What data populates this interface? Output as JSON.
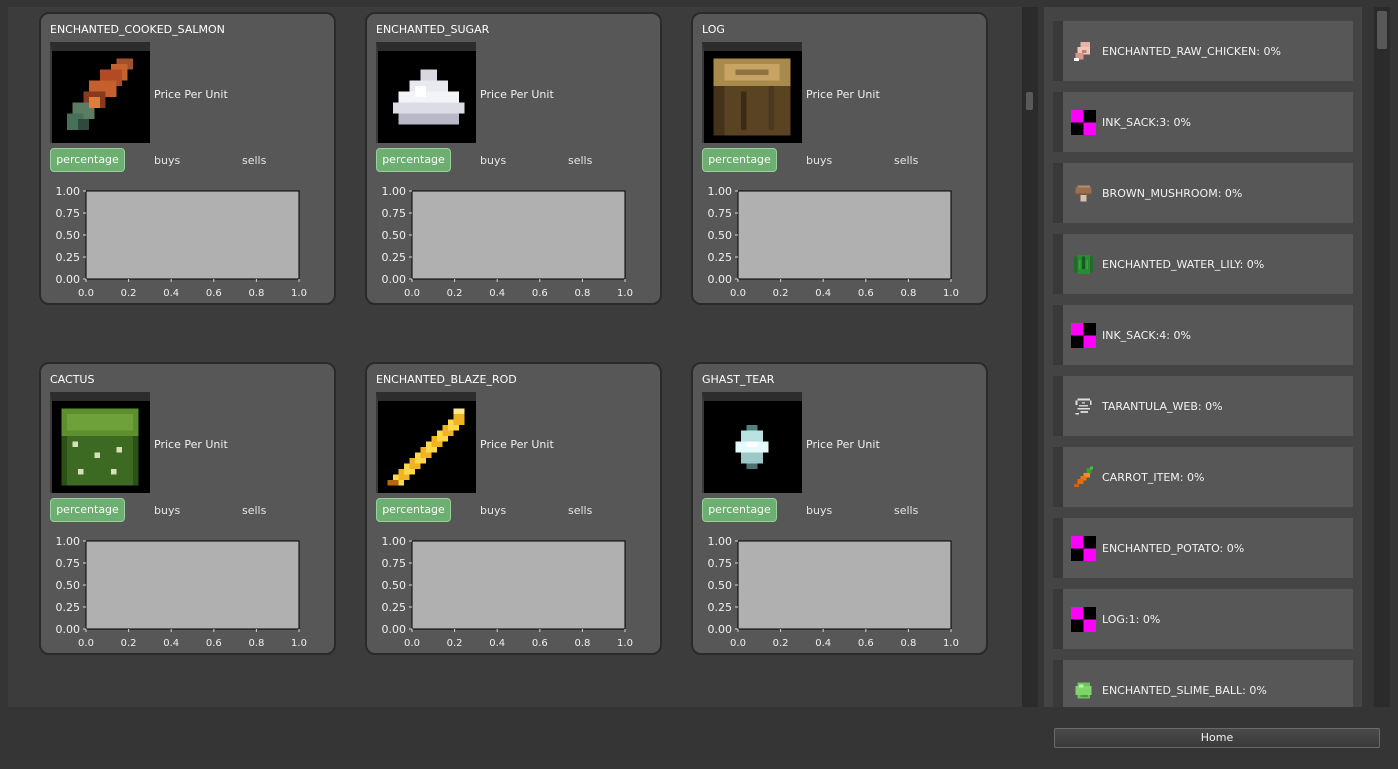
{
  "cards": [
    {
      "title": "ENCHANTED_COOKED_SALMON",
      "icon": "cooked-salmon-icon"
    },
    {
      "title": "ENCHANTED_SUGAR",
      "icon": "sugar-icon"
    },
    {
      "title": "LOG",
      "icon": "log-icon"
    },
    {
      "title": "CACTUS",
      "icon": "cactus-icon"
    },
    {
      "title": "ENCHANTED_BLAZE_ROD",
      "icon": "blaze-rod-icon"
    },
    {
      "title": "GHAST_TEAR",
      "icon": "ghast-tear-icon"
    }
  ],
  "card_labels": {
    "price_per_unit": "Price Per Unit",
    "percentage": "percentage",
    "buys": "buys",
    "sells": "sells"
  },
  "chart_data": [
    {
      "type": "line",
      "x": [],
      "series": [],
      "xlim": [
        0.0,
        1.0
      ],
      "ylim": [
        0.0,
        1.0
      ],
      "yticks": [
        "1.00",
        "0.75",
        "0.50",
        "0.25",
        "0.00"
      ],
      "xticks": [
        "0.0",
        "0.2",
        "0.4",
        "0.6",
        "0.8",
        "1.0"
      ]
    },
    {
      "type": "line",
      "x": [],
      "series": [],
      "xlim": [
        0.0,
        1.0
      ],
      "ylim": [
        0.0,
        1.0
      ],
      "yticks": [
        "1.00",
        "0.75",
        "0.50",
        "0.25",
        "0.00"
      ],
      "xticks": [
        "0.0",
        "0.2",
        "0.4",
        "0.6",
        "0.8",
        "1.0"
      ]
    },
    {
      "type": "line",
      "x": [],
      "series": [],
      "xlim": [
        0.0,
        1.0
      ],
      "ylim": [
        0.0,
        1.0
      ],
      "yticks": [
        "1.00",
        "0.75",
        "0.50",
        "0.25",
        "0.00"
      ],
      "xticks": [
        "0.0",
        "0.2",
        "0.4",
        "0.6",
        "0.8",
        "1.0"
      ]
    },
    {
      "type": "line",
      "x": [],
      "series": [],
      "xlim": [
        0.0,
        1.0
      ],
      "ylim": [
        0.0,
        1.0
      ],
      "yticks": [
        "1.00",
        "0.75",
        "0.50",
        "0.25",
        "0.00"
      ],
      "xticks": [
        "0.0",
        "0.2",
        "0.4",
        "0.6",
        "0.8",
        "1.0"
      ]
    },
    {
      "type": "line",
      "x": [],
      "series": [],
      "xlim": [
        0.0,
        1.0
      ],
      "ylim": [
        0.0,
        1.0
      ],
      "yticks": [
        "1.00",
        "0.75",
        "0.50",
        "0.25",
        "0.00"
      ],
      "xticks": [
        "0.0",
        "0.2",
        "0.4",
        "0.6",
        "0.8",
        "1.0"
      ]
    },
    {
      "type": "line",
      "x": [],
      "series": [],
      "xlim": [
        0.0,
        1.0
      ],
      "ylim": [
        0.0,
        1.0
      ],
      "yticks": [
        "1.00",
        "0.75",
        "0.50",
        "0.25",
        "0.00"
      ],
      "xticks": [
        "0.0",
        "0.2",
        "0.4",
        "0.6",
        "0.8",
        "1.0"
      ]
    }
  ],
  "sidebar": {
    "items": [
      {
        "label": "ENCHANTED_RAW_CHICKEN: 0%",
        "icon": "raw-chicken-icon"
      },
      {
        "label": "INK_SACK:3: 0%",
        "icon": "missing-texture-icon"
      },
      {
        "label": "BROWN_MUSHROOM: 0%",
        "icon": "brown-mushroom-icon"
      },
      {
        "label": "ENCHANTED_WATER_LILY: 0%",
        "icon": "water-lily-icon"
      },
      {
        "label": "INK_SACK:4: 0%",
        "icon": "missing-texture-icon"
      },
      {
        "label": "TARANTULA_WEB: 0%",
        "icon": "tarantula-web-icon"
      },
      {
        "label": "CARROT_ITEM: 0%",
        "icon": "carrot-icon"
      },
      {
        "label": "ENCHANTED_POTATO: 0%",
        "icon": "missing-texture-icon"
      },
      {
        "label": "LOG:1: 0%",
        "icon": "missing-texture-icon"
      },
      {
        "label": "ENCHANTED_SLIME_BALL: 0%",
        "icon": "slime-ball-icon"
      }
    ]
  },
  "home_button": "Home",
  "colors": {
    "percentage_button": "#6fae73",
    "card_bg": "#575757",
    "chart_plot_bg": "#b0b0b0",
    "missing_texture": "#ff00ff"
  }
}
